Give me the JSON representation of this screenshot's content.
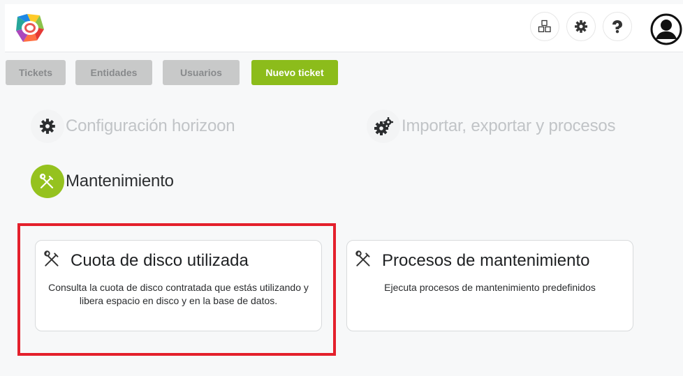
{
  "header": {
    "logo_icon": "horizoon-logo",
    "icons": [
      "modules-icon",
      "gear-icon",
      "help-icon"
    ],
    "user_icon": "user-avatar-icon"
  },
  "nav": {
    "tabs": [
      {
        "label": "Tickets"
      },
      {
        "label": "Entidades"
      },
      {
        "label": "Usuarios"
      }
    ],
    "new_ticket_label": "Nuevo ticket"
  },
  "sections": {
    "config": {
      "label": "Configuración horizoon",
      "icon": "gear-icon"
    },
    "import": {
      "label": "Importar, exportar y procesos",
      "icon": "gears-icon"
    },
    "maintenance": {
      "label": "Mantenimiento",
      "icon": "tools-icon"
    }
  },
  "cards": [
    {
      "title": "Cuota de disco utilizada",
      "description": "Consulta la cuota de disco contratada que estás utilizando y libera espacio en disco y en la base de datos.",
      "icon": "tools-icon"
    },
    {
      "title": "Procesos de mantenimiento",
      "description": "Ejecuta procesos de mantenimiento predefinidos",
      "icon": "tools-icon"
    }
  ],
  "colors": {
    "accent": "#8cbc1b",
    "tab_inactive": "#c8c9c9",
    "highlight": "#e4202c"
  }
}
